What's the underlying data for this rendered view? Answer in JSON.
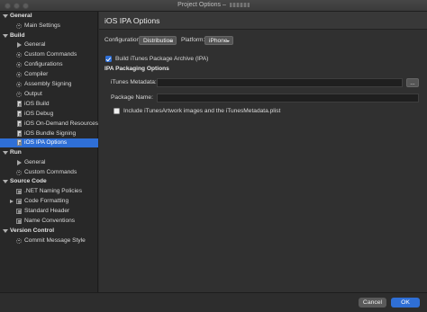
{
  "window": {
    "title": "Project Options – "
  },
  "sidebar": {
    "sections": [
      {
        "label": "General",
        "items": [
          {
            "label": "Main Settings",
            "icon": "settings-icon"
          }
        ]
      },
      {
        "label": "Build",
        "items": [
          {
            "label": "General",
            "icon": "play-icon"
          },
          {
            "label": "Custom Commands",
            "icon": "gear-icon"
          },
          {
            "label": "Configurations",
            "icon": "gear-icon"
          },
          {
            "label": "Compiler",
            "icon": "gear-icon"
          },
          {
            "label": "Assembly Signing",
            "icon": "gear-icon"
          },
          {
            "label": "Output",
            "icon": "gear-icon"
          },
          {
            "label": "iOS Build",
            "icon": "document-icon"
          },
          {
            "label": "iOS Debug",
            "icon": "document-icon"
          },
          {
            "label": "iOS On-Demand Resources",
            "icon": "document-icon"
          },
          {
            "label": "iOS Bundle Signing",
            "icon": "document-icon"
          },
          {
            "label": "iOS IPA Options",
            "icon": "document-icon",
            "selected": true
          }
        ]
      },
      {
        "label": "Run",
        "items": [
          {
            "label": "General",
            "icon": "play-icon"
          },
          {
            "label": "Custom Commands",
            "icon": "gear-icon"
          }
        ]
      },
      {
        "label": "Source Code",
        "items": [
          {
            "label": ".NET Naming Policies",
            "icon": "list-icon"
          },
          {
            "label": "Code Formatting",
            "icon": "list-icon",
            "collapsed": true
          },
          {
            "label": "Standard Header",
            "icon": "list-icon"
          },
          {
            "label": "Name Conventions",
            "icon": "list-icon"
          }
        ]
      },
      {
        "label": "Version Control",
        "items": [
          {
            "label": "Commit Message Style",
            "icon": "settings-icon"
          }
        ]
      }
    ]
  },
  "main": {
    "title": "iOS IPA Options",
    "configuration_label": "Configuration:",
    "configuration_value": "Distribution",
    "platform_label": "Platform:",
    "platform_value": "iPhone",
    "build_archive_label": "Build iTunes Package Archive (IPA)",
    "build_archive_checked": true,
    "packaging_header": "IPA Packaging Options",
    "metadata_label": "iTunes Metadata:",
    "metadata_value": "",
    "browse_label": "...",
    "package_name_label": "Package Name:",
    "package_name_value": "",
    "include_artwork_label": "Include iTunesArtwork images and the iTunesMetadata.plist",
    "include_artwork_checked": false
  },
  "footer": {
    "cancel_label": "Cancel",
    "ok_label": "OK"
  },
  "colors": {
    "accent": "#2f6fd6",
    "background": "#303030",
    "sidebar": "#282828"
  }
}
